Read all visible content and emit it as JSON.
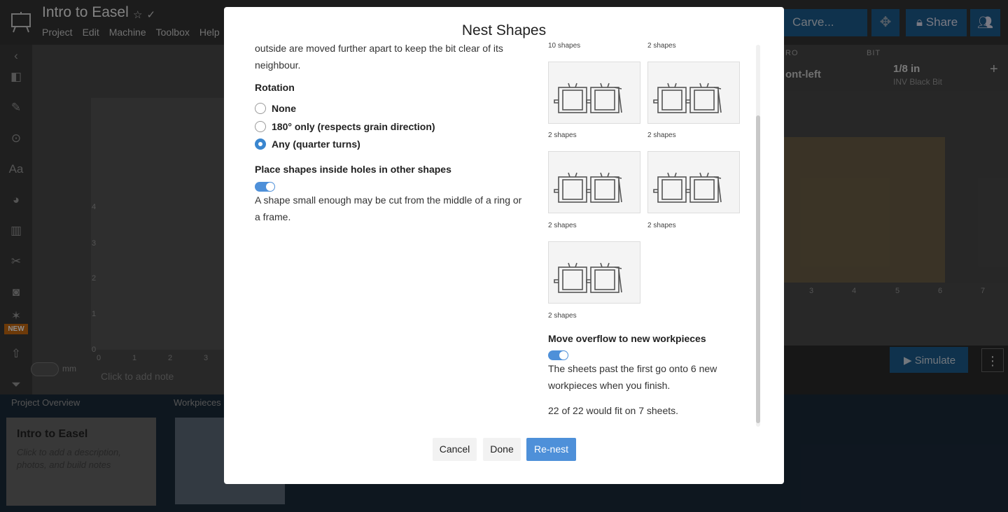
{
  "app": {
    "project_title": "Intro to Easel",
    "menu": [
      "Project",
      "Edit",
      "Machine",
      "Toolbox",
      "Help"
    ],
    "carve_label": "Carve...",
    "share_label": "Share"
  },
  "canvas": {
    "y_ticks": [
      "4",
      "3",
      "2",
      "1",
      "0"
    ],
    "x_ticks": [
      "0",
      "1",
      "2",
      "3"
    ],
    "unit": "mm",
    "add_note": "Click to add note"
  },
  "right_panel": {
    "zero_label": "RO",
    "zero_value": "ont-left",
    "bit_label": "BIT",
    "bit_size": "1/8 in",
    "bit_name": "INV Black Bit",
    "x_ticks": [
      "3",
      "4",
      "5",
      "6",
      "7"
    ],
    "simulate_label": "Simulate"
  },
  "tools": {
    "new_badge": "NEW",
    "text_tool": "Aa"
  },
  "bottom": {
    "overview_header": "Project Overview",
    "workpieces_header": "Workpieces",
    "overview_title": "Intro to Easel",
    "overview_desc": "Click to add a description, photos, and build notes"
  },
  "modal": {
    "title": "Nest Shapes",
    "intro_text": "outside are moved further apart to keep the bit clear of its neighbour.",
    "rotation_heading": "Rotation",
    "rotation_options": [
      {
        "label": "None",
        "selected": false
      },
      {
        "label": "180° only (respects grain direction)",
        "selected": false
      },
      {
        "label": "Any (quarter turns)",
        "selected": true
      }
    ],
    "holes_heading": "Place shapes inside holes in other shapes",
    "holes_enabled": true,
    "holes_desc": "A shape small enough may be cut from the middle of a ring or a frame.",
    "sheets": [
      {
        "caption": "10 shapes"
      },
      {
        "caption": "2 shapes"
      },
      {
        "caption": "2 shapes"
      },
      {
        "caption": "2 shapes"
      },
      {
        "caption": "2 shapes"
      },
      {
        "caption": "2 shapes"
      },
      {
        "caption": "2 shapes"
      }
    ],
    "overflow_heading": "Move overflow to new workpieces",
    "overflow_enabled": true,
    "overflow_desc": "The sheets past the first go onto 6 new workpieces when you finish.",
    "fit_text": "22 of 22 would fit on 7 sheets.",
    "cancel_label": "Cancel",
    "done_label": "Done",
    "renest_label": "Re-nest"
  }
}
